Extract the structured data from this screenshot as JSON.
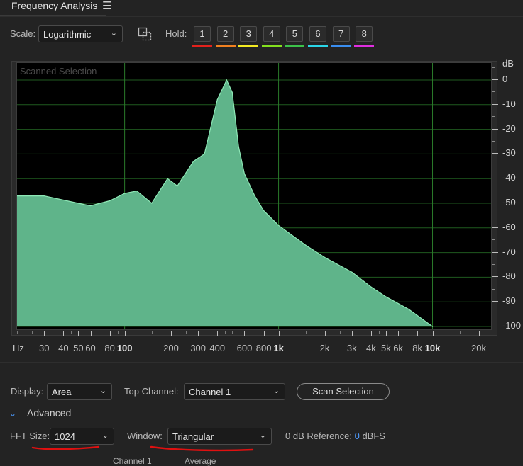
{
  "panel": {
    "title": "Frequency Analysis",
    "menu_icon": "hamburger-menu-icon"
  },
  "toolbar": {
    "scale_label": "Scale:",
    "scale_value": "Logarithmic",
    "marquee_icon": "marquee-select-icon",
    "hold_label": "Hold:",
    "hold_buttons": [
      {
        "label": "1",
        "color": "#e3211c"
      },
      {
        "label": "2",
        "color": "#f08020"
      },
      {
        "label": "3",
        "color": "#f3ea22"
      },
      {
        "label": "4",
        "color": "#84e01e"
      },
      {
        "label": "5",
        "color": "#3cc24a"
      },
      {
        "label": "6",
        "color": "#2ad6e8"
      },
      {
        "label": "7",
        "color": "#3a8ef0"
      },
      {
        "label": "8",
        "color": "#e02ee0"
      }
    ]
  },
  "graph": {
    "overlay_label": "Scanned Selection",
    "y_unit": "dB",
    "y_ticks": [
      "0",
      "-10",
      "-20",
      "-30",
      "-40",
      "-50",
      "-60",
      "-70",
      "-80",
      "-90",
      "-100"
    ],
    "x_unit": "Hz",
    "x_ticks": [
      "30",
      "40",
      "50",
      "60",
      "80",
      "100",
      "200",
      "300",
      "400",
      "600",
      "800",
      "1k",
      "2k",
      "3k",
      "4k",
      "5k",
      "6k",
      "8k",
      "10k",
      "20k"
    ],
    "fill_color": "#5fb48a",
    "edge_color": "#8ee8b6",
    "grid_color": "#1f5a1f"
  },
  "chart_data": {
    "type": "area",
    "x_scale": "log",
    "xlim": [
      20,
      24000
    ],
    "ylim": [
      -100,
      0
    ],
    "xlabel": "Hz",
    "ylabel": "dB",
    "grid": true,
    "x": [
      20,
      30,
      50,
      60,
      80,
      100,
      120,
      150,
      190,
      220,
      280,
      330,
      400,
      460,
      500,
      550,
      600,
      700,
      800,
      1000,
      1500,
      2000,
      3000,
      4000,
      5000,
      7000,
      10000
    ],
    "y": [
      -47,
      -47,
      -50,
      -51,
      -49,
      -46,
      -45,
      -50,
      -40,
      -43,
      -33,
      -30,
      -8,
      0,
      -5,
      -27,
      -38,
      -47,
      -53,
      -59,
      -67,
      -72,
      -78,
      -84,
      -88,
      -93,
      -100
    ]
  },
  "controls": {
    "display_label": "Display:",
    "display_value": "Area",
    "top_channel_label": "Top Channel:",
    "top_channel_value": "Channel 1",
    "scan_button": "Scan Selection",
    "advanced_label": "Advanced",
    "fft_label": "FFT Size:",
    "fft_value": "1024",
    "window_label": "Window:",
    "window_value": "Triangular",
    "ref_label": "0 dB Reference:",
    "ref_value": "0",
    "ref_unit": "dBFS",
    "cut_col1": "Channel 1",
    "cut_col2": "Average",
    "annotation_color": "#e01010"
  }
}
